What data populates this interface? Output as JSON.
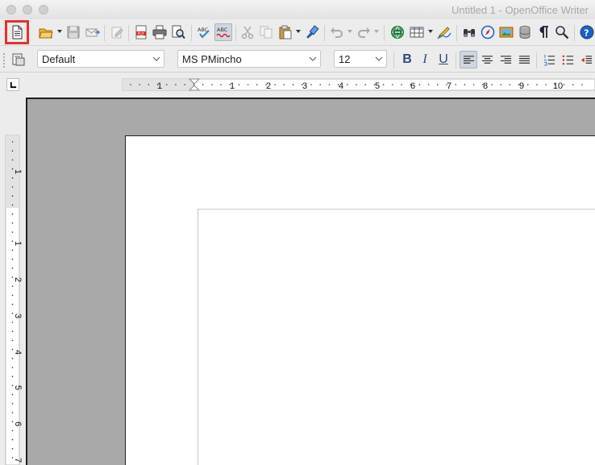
{
  "window": {
    "title": "Untitled 1 - OpenOffice Writer"
  },
  "formatting": {
    "paragraph_style": "Default",
    "font_name": "MS PMincho",
    "font_size": "12",
    "bold_label": "B",
    "italic_label": "I",
    "underline_label": "U"
  },
  "ruler": {
    "horizontal_marks": [
      "1",
      "1",
      "2",
      "3",
      "4",
      "5",
      "6",
      "7",
      "8",
      "9",
      "10"
    ],
    "vertical_marks": [
      "1",
      "1",
      "2",
      "3",
      "4",
      "5",
      "6",
      "7"
    ]
  },
  "colors": {
    "highlight": "#e53030",
    "workspace": "#a9a9a9",
    "accent": "#2b4a7a"
  },
  "icons": {
    "new": "new-document-icon",
    "open": "open-icon",
    "save": "save-icon",
    "email": "email-icon",
    "edit": "edit-file-icon",
    "pdf": "export-pdf-icon",
    "print": "print-icon",
    "preview": "print-preview-icon",
    "spell": "spellcheck-icon",
    "autospell": "autospellcheck-icon",
    "cut": "cut-icon",
    "copy": "copy-icon",
    "paste": "paste-icon",
    "brush": "clone-formatting-icon",
    "undo": "undo-icon",
    "redo": "redo-icon",
    "hyperlink": "hyperlink-icon",
    "table": "table-icon",
    "draw": "draw-functions-icon",
    "find": "find-replace-icon",
    "navigator": "navigator-icon",
    "gallery": "gallery-icon",
    "datasources": "data-sources-icon",
    "pilcrow": "formatting-marks-icon",
    "zoom": "zoom-icon",
    "help": "help-icon"
  }
}
